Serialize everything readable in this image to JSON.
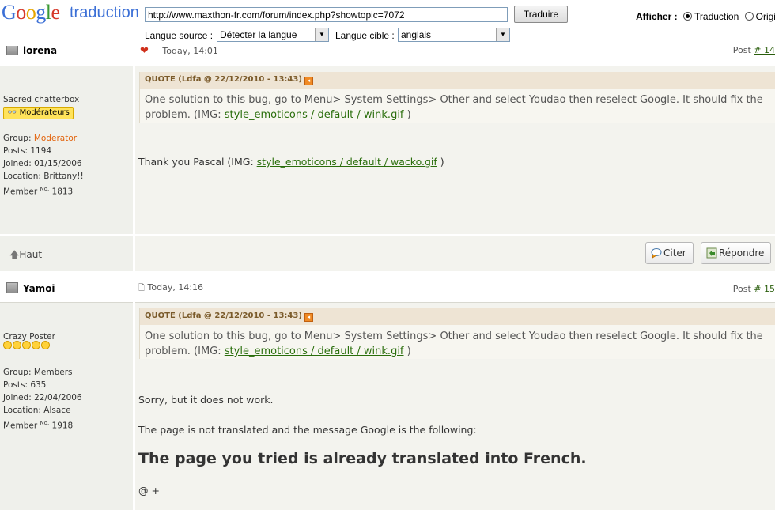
{
  "translate_bar": {
    "logo_google": "Google",
    "logo_traduction": "traduction",
    "url_value": "http://www.maxthon-fr.com/forum/index.php?showtopic=7072",
    "translate_button": "Traduire",
    "source_label": "Langue source :",
    "source_value": "Détecter la langue",
    "target_label": "Langue cible :",
    "target_value": "anglais",
    "afficher_label": "Afficher :",
    "option_translation": "Traduction",
    "option_original": "Origi"
  },
  "post1": {
    "author": "lorena",
    "date": "Today, 14:01",
    "post_num_prefix": "Post",
    "post_num_link": "# 14",
    "profile": {
      "title": "Sacred chatterbox",
      "badge": "Modérateurs",
      "group_label": "Group:",
      "group": "Moderator",
      "posts": "Posts: 1194",
      "joined": "Joined: 01/15/2006",
      "location": "Location: Brittany!!",
      "member_label": "Member",
      "member_no": "No.",
      "member_num": "1813"
    },
    "quote_header": "QUOTE (Ldfa @ 22/12/2010 - 13:43)",
    "quote_text": "One solution to this bug, go to Menu> System Settings> Other and select Youdao then reselect Google.  It should fix the problem. (IMG:",
    "quote_link": "style_emoticons / default / wink.gif",
    "quote_close": ")",
    "body_text": "Thank you Pascal (IMG:",
    "body_link": "style_emoticons / default / wacko.gif",
    "body_close": ")"
  },
  "actions": {
    "top_label": "Haut",
    "quote_button": "Citer",
    "reply_button": "Répondre"
  },
  "post2": {
    "author": "Yamoi",
    "date": "Today, 14:16",
    "post_num_prefix": "Post",
    "post_num_link": "# 15",
    "profile": {
      "title": "Crazy Poster",
      "group": "Group: Members",
      "posts": "Posts: 635",
      "joined": "Joined: 22/04/2006",
      "location": "Location: Alsace",
      "member_label": "Member",
      "member_no": "No.",
      "member_num": "1918"
    },
    "quote_header": "QUOTE (Ldfa @ 22/12/2010 - 13:43)",
    "quote_text": "One solution to this bug, go to Menu> System Settings> Other and select Youdao then reselect Google.  It should fix the problem. (IMG:",
    "quote_link": "style_emoticons / default / wink.gif",
    "quote_close": ")",
    "line1": "Sorry, but it does not work.",
    "line2": "The page is not translated and the message Google is the following:",
    "big_message": "The page you tried is already translated into French.",
    "footer": "@ +"
  }
}
